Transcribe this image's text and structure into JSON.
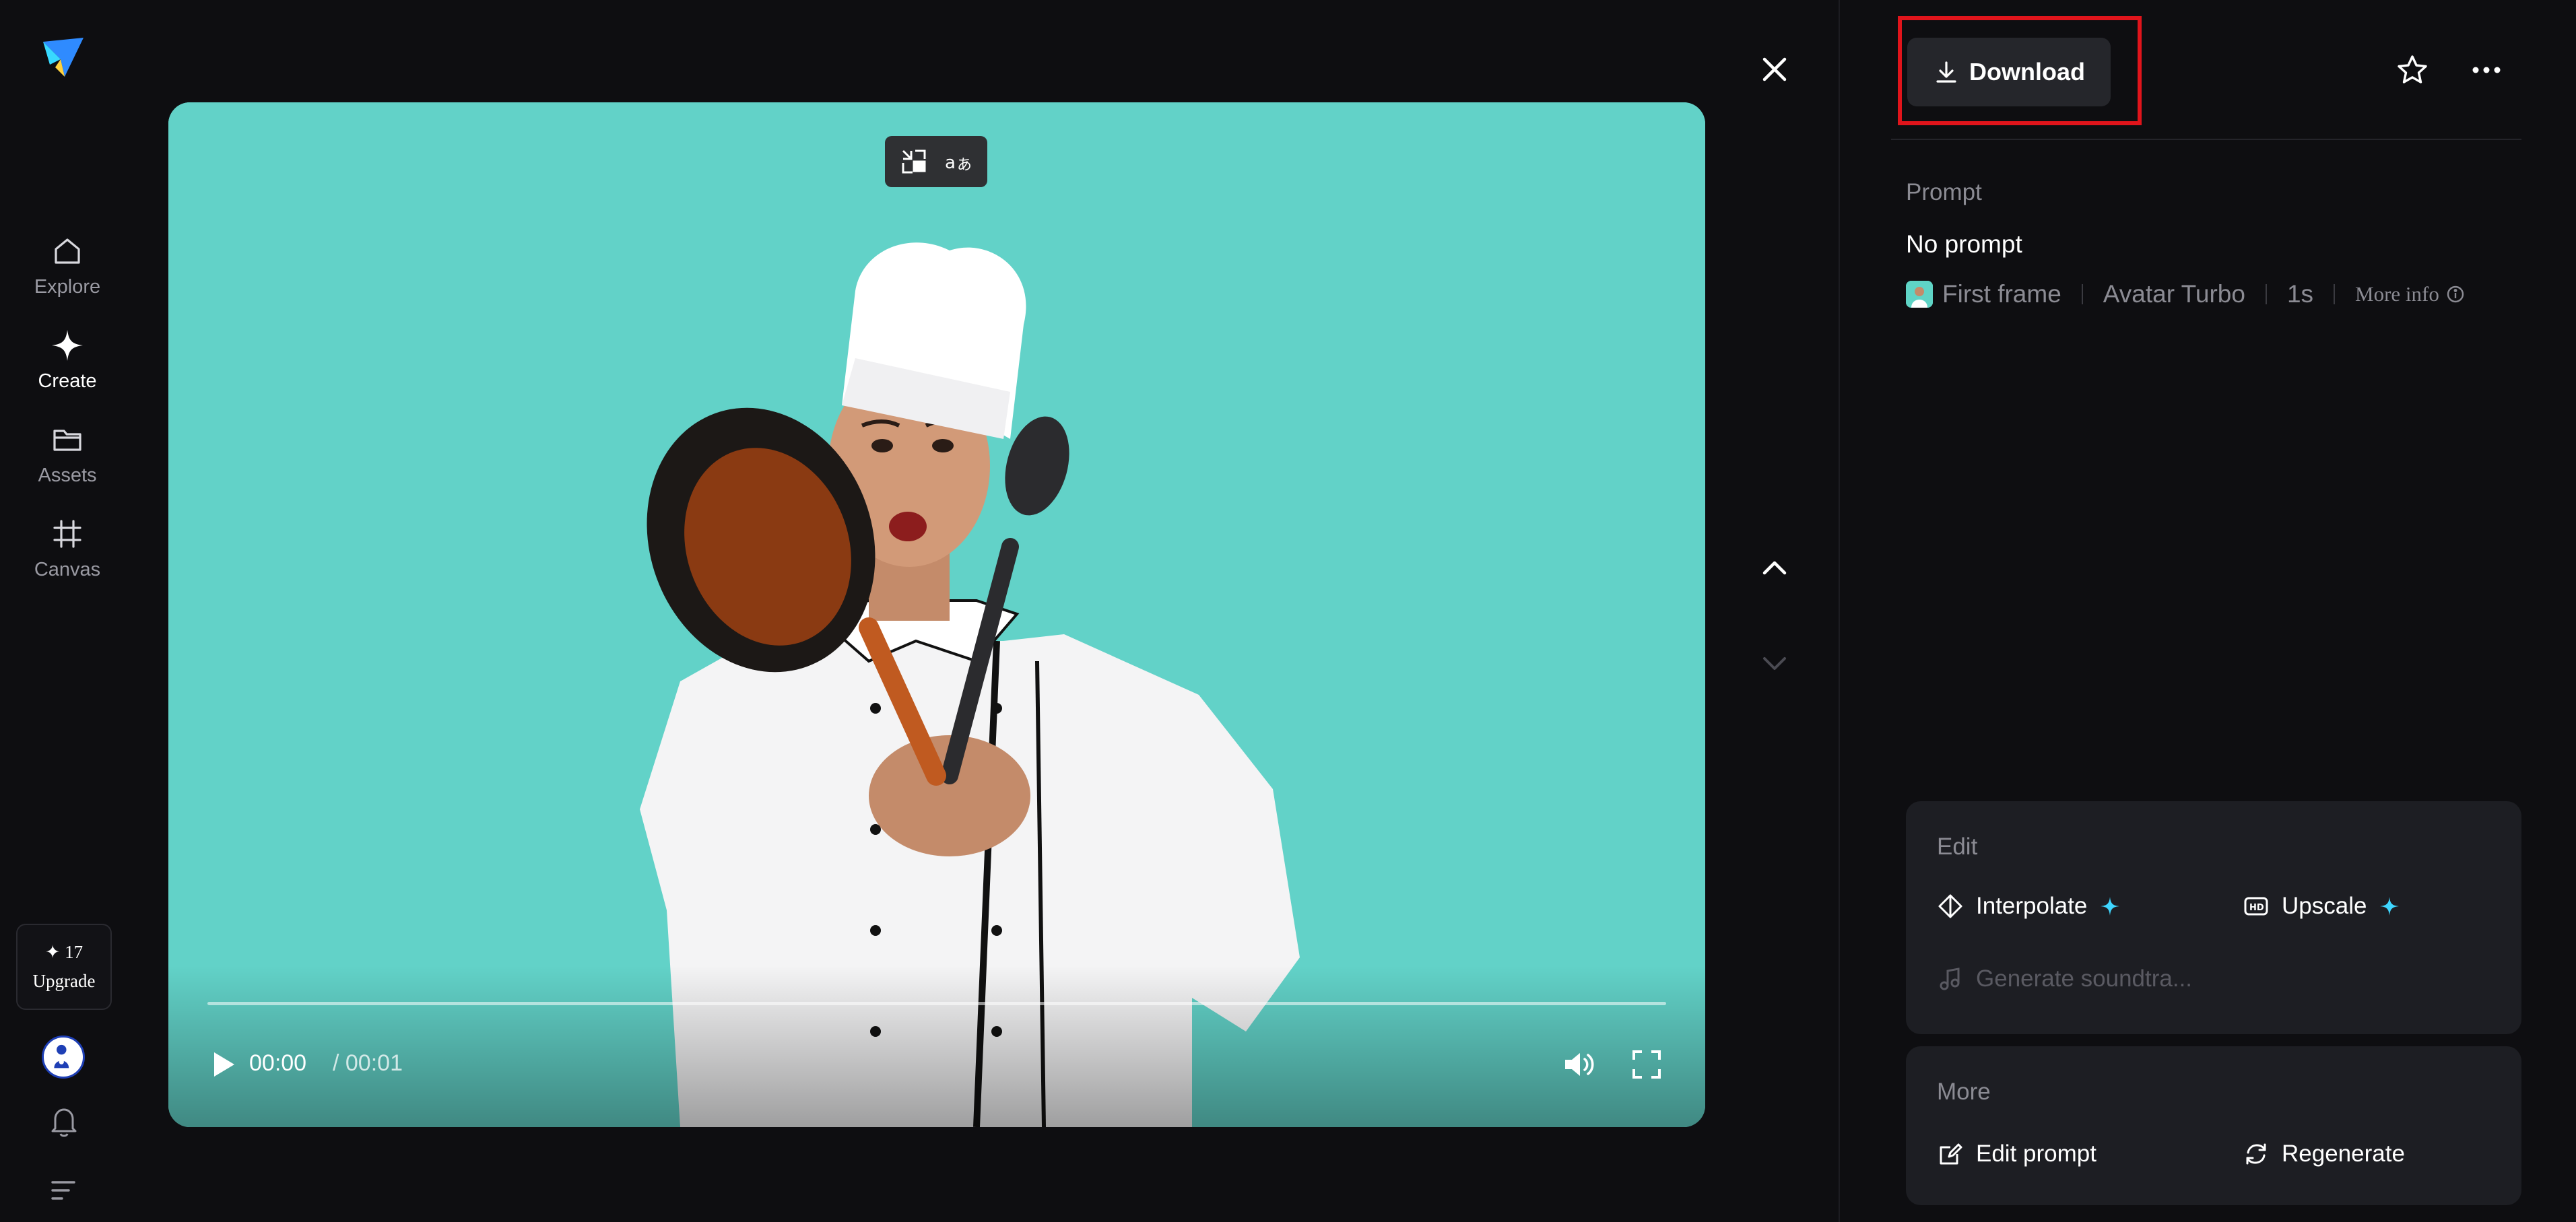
{
  "sidebar": {
    "items": [
      {
        "label": "Explore",
        "icon": "home-icon",
        "active": false
      },
      {
        "label": "Create",
        "icon": "sparkle-icon",
        "active": true
      },
      {
        "label": "Assets",
        "icon": "folder-icon",
        "active": false
      },
      {
        "label": "Canvas",
        "icon": "canvas-grid-icon",
        "active": false
      }
    ],
    "upgrade": {
      "credits": "✦ 17",
      "label": "Upgrade"
    }
  },
  "player": {
    "current_time": "00:00",
    "separator_duration": "/ 00:01",
    "progress": 0
  },
  "panel": {
    "download_label": "Download",
    "prompt_label": "Prompt",
    "prompt_value": "No prompt",
    "meta": {
      "first_frame": "First frame",
      "model": "Avatar Turbo",
      "duration": "1s",
      "more_info": "More info"
    },
    "edit": {
      "title": "Edit",
      "interpolate": "Interpolate",
      "upscale": "Upscale",
      "generate_soundtrack": "Generate soundtra..."
    },
    "more": {
      "title": "More",
      "edit_prompt": "Edit prompt",
      "regenerate": "Regenerate"
    }
  },
  "colors": {
    "background": "#0e0e11",
    "video_bg": "#62d2c8",
    "accent_sparkle": "#3fd6ff",
    "highlight": "#e0141b"
  }
}
